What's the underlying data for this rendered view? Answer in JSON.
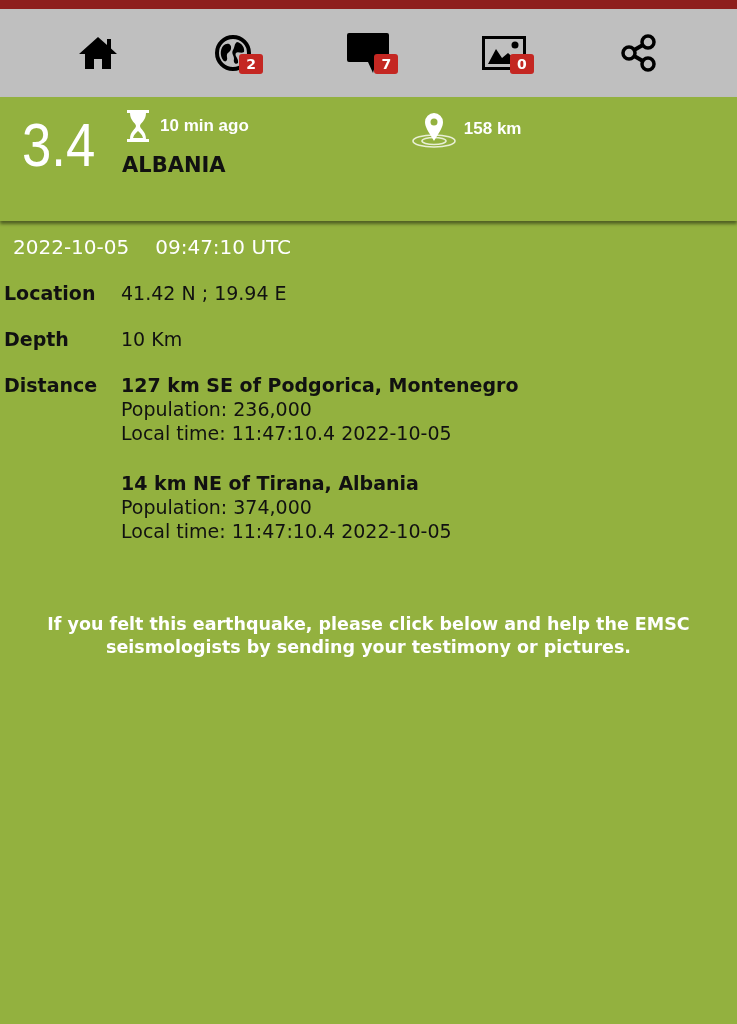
{
  "toolbar": [
    {
      "kind": "home"
    },
    {
      "kind": "globe",
      "badge": "2"
    },
    {
      "kind": "comment",
      "badge": "7"
    },
    {
      "kind": "image",
      "badge": "0"
    },
    {
      "kind": "share"
    }
  ],
  "summary": {
    "magnitude": "3.4",
    "time_ago": "10 min ago",
    "region": "ALBANIA",
    "distance": "158 km"
  },
  "details": {
    "date": "2022-10-05",
    "time": "09:47:10 UTC",
    "rows": [
      {
        "label": "Location",
        "value": "41.42 N ; 19.94 E"
      },
      {
        "label": "Depth",
        "value": "10 Km"
      }
    ],
    "distance_label": "Distance",
    "distances": [
      {
        "place": "127 km SE of Podgorica, Montenegro",
        "population": "Population: 236,000",
        "local_time": "Local time: 11:47:10.4 2022-10-05"
      },
      {
        "place": "14 km NE of Tirana, Albania",
        "population": "Population: 374,000",
        "local_time": "Local time: 11:47:10.4 2022-10-05"
      }
    ]
  },
  "note": "If you felt this earthquake, please click below and help the EMSC seismologists by sending your testimony or pictures."
}
